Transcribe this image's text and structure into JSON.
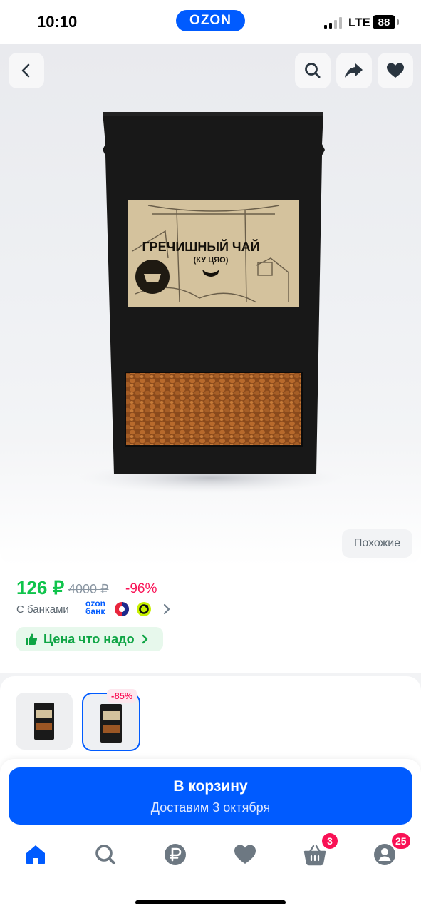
{
  "status_bar": {
    "time": "10:10",
    "network": "LTE",
    "battery": "88"
  },
  "header": {
    "logo": "OZON"
  },
  "gallery": {
    "toolbar_icons": [
      "back-chevron-icon",
      "search-icon",
      "share-icon",
      "heart-icon"
    ],
    "package_title": "ГРЕЧИШНЫЙ ЧАЙ",
    "package_subtitle": "(КУ ЦЯО)",
    "similar_label": "Похожие"
  },
  "price": {
    "current": "126 ₽",
    "old": "4000 ₽",
    "discount": "-96%",
    "banks_label": "С банками",
    "ozon_bank_line1": "ozon",
    "ozon_bank_line2": "банк",
    "badge_label": "Цена что надо"
  },
  "thumbnails": {
    "count": 2,
    "selected_index": 1,
    "badge": "-85%"
  },
  "cart": {
    "label": "В корзину",
    "delivery": "Доставим 3 октября"
  },
  "bottom_nav": {
    "items": [
      "home-icon",
      "search-icon",
      "ruble-icon",
      "heart-icon",
      "cart-icon",
      "profile-icon"
    ],
    "cart_badge": "3",
    "profile_badge": "25"
  },
  "colors": {
    "accent": "#005bff",
    "price_green": "#10c44c",
    "discount_pink": "#f91155",
    "badge_green": "#0fa545",
    "badge_bg": "#e7f8ec"
  }
}
